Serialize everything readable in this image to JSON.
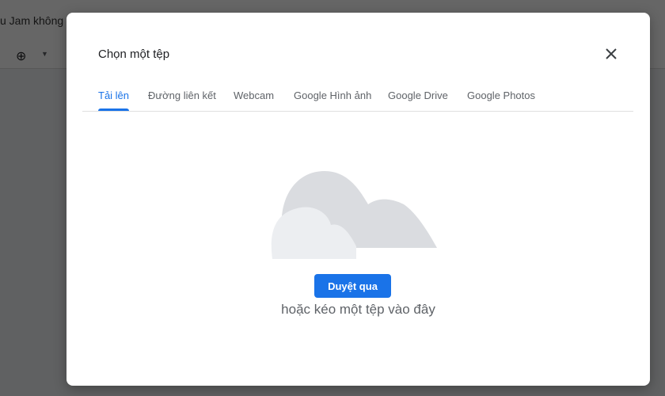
{
  "background_app": {
    "title_fragment": "u Jam không",
    "zoom_icon": "zoom-in-icon"
  },
  "dialog": {
    "title": "Chọn một tệp",
    "close_icon": "close-icon",
    "tabs": [
      {
        "label": "Tải lên",
        "active": true
      },
      {
        "label": "Đường liên kết",
        "active": false
      },
      {
        "label": "Webcam",
        "active": false
      },
      {
        "label": "Google Hình ảnh",
        "active": false
      },
      {
        "label": "Google Drive",
        "active": false
      },
      {
        "label": "Google Photos",
        "active": false
      }
    ],
    "browse_button": "Duyệt qua",
    "drop_hint": "hoặc kéo một tệp vào đây",
    "illustration": "cloud-icon"
  },
  "colors": {
    "accent": "#1a73e8",
    "cloud_back": "#dadce0",
    "cloud_front": "#eceef1"
  }
}
